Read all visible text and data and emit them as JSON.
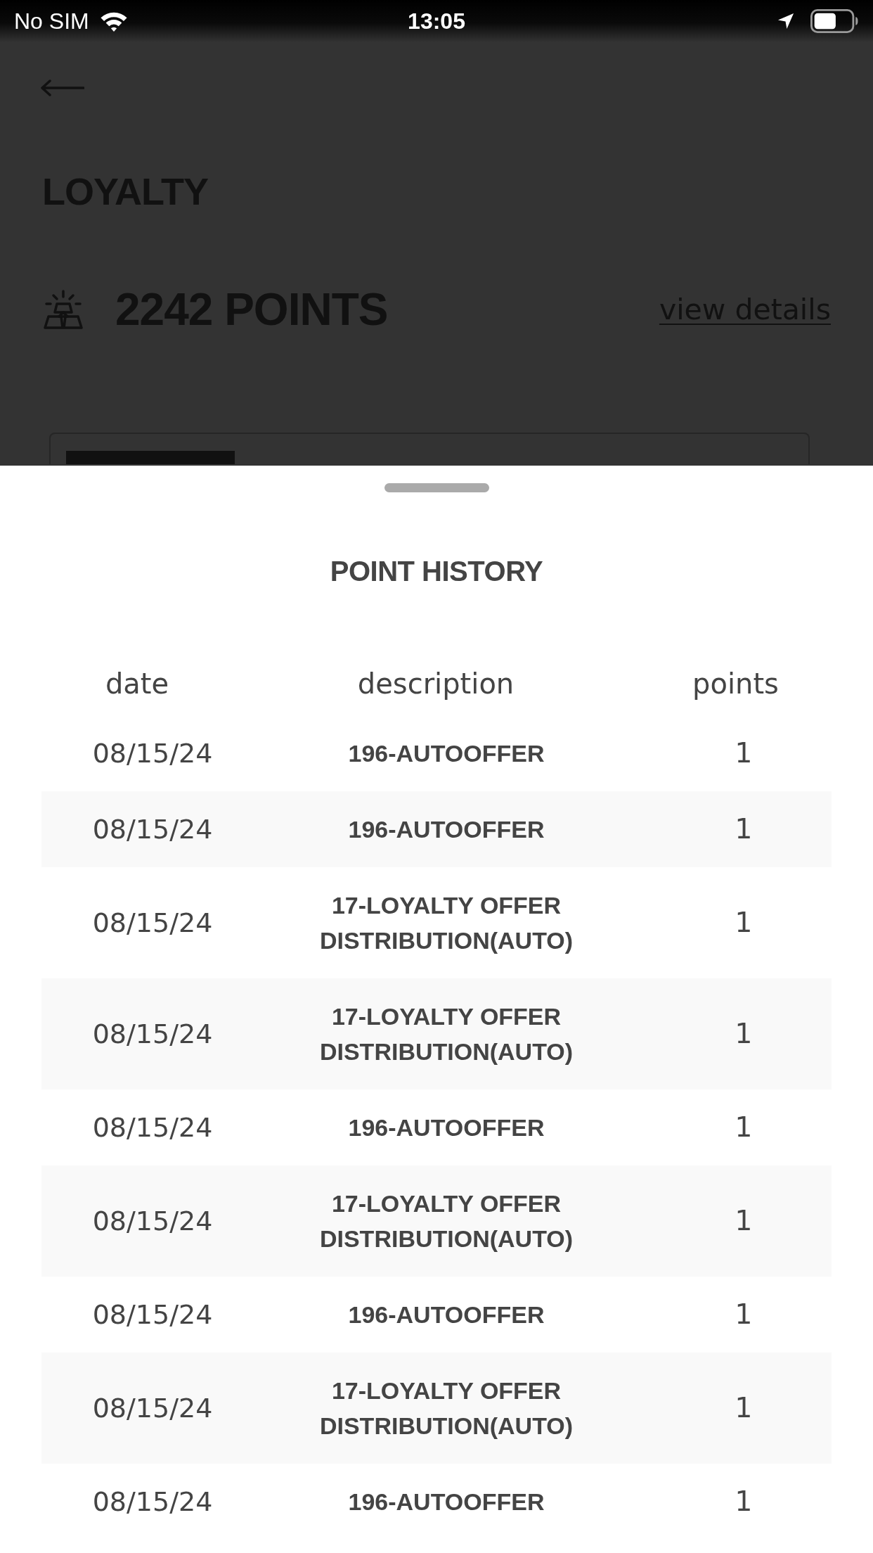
{
  "status_bar": {
    "carrier": "No SIM",
    "time": "13:05"
  },
  "header": {
    "title": "LOYALTY"
  },
  "points_summary": {
    "points": "2242 POINTS",
    "link": "view details"
  },
  "point_history": {
    "title": "POINT HISTORY",
    "columns": [
      "date",
      "description",
      "points"
    ],
    "rows": [
      {
        "date": "08/15/24",
        "description": "196-AUTOOFFER",
        "points": "1"
      },
      {
        "date": "08/15/24",
        "description": "196-AUTOOFFER",
        "points": "1"
      },
      {
        "date": "08/15/24",
        "description": "17-LOYALTY OFFER DISTRIBUTION(AUTO)",
        "points": "1"
      },
      {
        "date": "08/15/24",
        "description": "17-LOYALTY OFFER DISTRIBUTION(AUTO)",
        "points": "1"
      },
      {
        "date": "08/15/24",
        "description": "196-AUTOOFFER",
        "points": "1"
      },
      {
        "date": "08/15/24",
        "description": "17-LOYALTY OFFER DISTRIBUTION(AUTO)",
        "points": "1"
      },
      {
        "date": "08/15/24",
        "description": "196-AUTOOFFER",
        "points": "1"
      },
      {
        "date": "08/15/24",
        "description": "17-LOYALTY OFFER DISTRIBUTION(AUTO)",
        "points": "1"
      },
      {
        "date": "08/15/24",
        "description": "196-AUTOOFFER",
        "points": "1"
      }
    ]
  }
}
